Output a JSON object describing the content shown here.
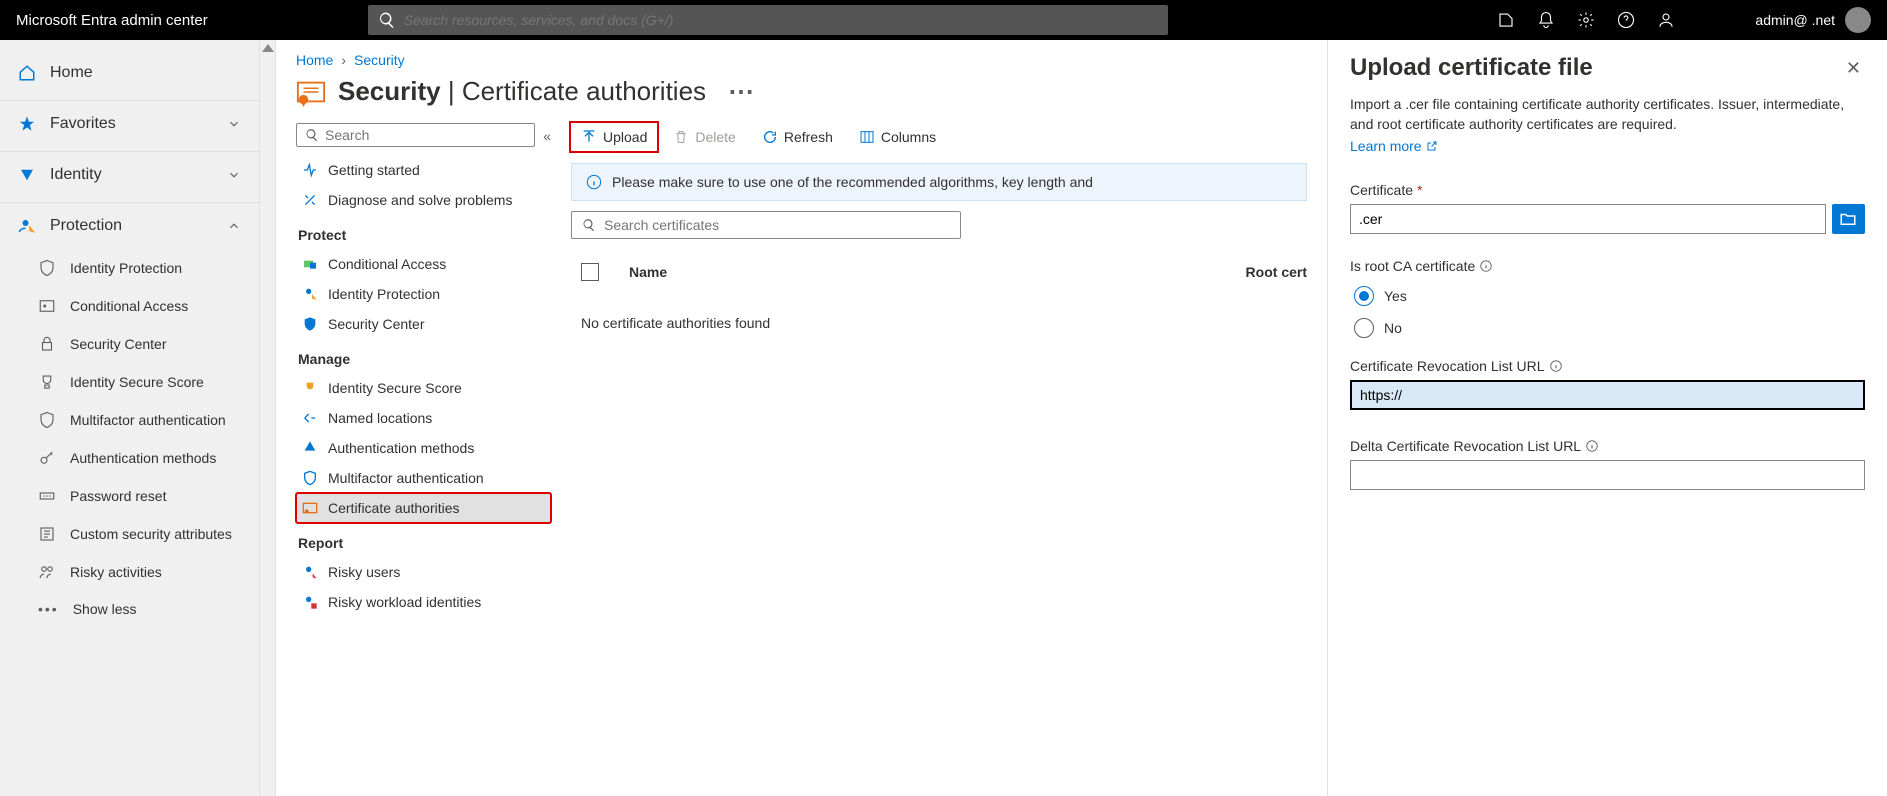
{
  "header": {
    "brand": "Microsoft Entra admin center",
    "search_placeholder": "Search resources, services, and docs (G+/)",
    "user_label": "admin@ .net"
  },
  "leftnav": {
    "home": "Home",
    "favorites": "Favorites",
    "identity": "Identity",
    "protection": "Protection",
    "protection_items": [
      "Identity Protection",
      "Conditional Access",
      "Security Center",
      "Identity Secure Score",
      "Multifactor authentication",
      "Authentication methods",
      "Password reset",
      "Custom security attributes",
      "Risky activities",
      "Show less"
    ]
  },
  "breadcrumb": {
    "home": "Home",
    "security": "Security"
  },
  "page": {
    "title_main": "Security",
    "title_sep": " | ",
    "title_sub": "Certificate authorities"
  },
  "subnav": {
    "search_placeholder": "Search",
    "items_top": [
      "Getting started",
      "Diagnose and solve problems"
    ],
    "section_protect": "Protect",
    "items_protect": [
      "Conditional Access",
      "Identity Protection",
      "Security Center"
    ],
    "section_manage": "Manage",
    "items_manage": [
      "Identity Secure Score",
      "Named locations",
      "Authentication methods",
      "Multifactor authentication",
      "Certificate authorities"
    ],
    "section_report": "Report",
    "items_report": [
      "Risky users",
      "Risky workload identities"
    ]
  },
  "toolbar": {
    "upload": "Upload",
    "delete": "Delete",
    "refresh": "Refresh",
    "columns": "Columns"
  },
  "banner": "Please make sure to use one of the recommended algorithms, key length and",
  "list": {
    "search_placeholder": "Search certificates",
    "col_name": "Name",
    "col_root": "Root cert",
    "empty": "No certificate authorities found"
  },
  "flyout": {
    "title": "Upload certificate file",
    "desc": "Import a .cer file containing certificate authority certificates. Issuer, intermediate, and root certificate authority certificates are required.",
    "learn": "Learn more",
    "cert_label": "Certificate",
    "cert_value": ".cer",
    "isroot_label": "Is root CA certificate",
    "yes": "Yes",
    "no": "No",
    "crl_label": "Certificate Revocation List URL",
    "crl_value": "https://",
    "delta_label": "Delta Certificate Revocation List URL"
  }
}
